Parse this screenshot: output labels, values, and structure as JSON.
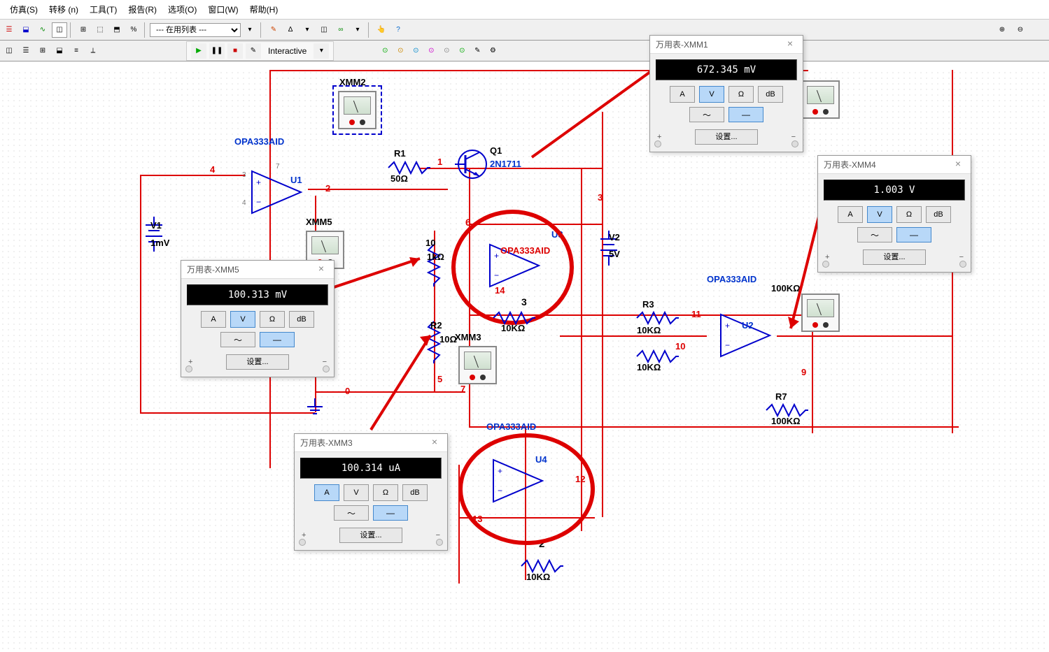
{
  "menu": {
    "sim": "仿真(S)",
    "trans": "转移 (n)",
    "tool": "工具(T)",
    "report": "报告(R)",
    "opt": "选项(O)",
    "win": "窗口(W)",
    "help": "帮助(H)"
  },
  "toolbar": {
    "list": "--- 在用列表 ---",
    "interactive": "Interactive"
  },
  "multimeters": {
    "xmm1": {
      "title": "万用表-XMM1",
      "reading": "672.345 mV",
      "mode": "V",
      "wave": "dc",
      "set": "设置..."
    },
    "xmm3": {
      "title": "万用表-XMM3",
      "reading": "100.314 uA",
      "mode": "A",
      "wave": "dc",
      "set": "设置..."
    },
    "xmm4": {
      "title": "万用表-XMM4",
      "reading": "1.003 V",
      "mode": "V",
      "wave": "dc",
      "set": "设置..."
    },
    "xmm5": {
      "title": "万用表-XMM5",
      "reading": "100.313 mV",
      "mode": "V",
      "wave": "dc",
      "set": "设置..."
    }
  },
  "components": {
    "v1": {
      "ref": "V1",
      "val": "1mV"
    },
    "v2": {
      "ref": "V2",
      "val": "5V"
    },
    "u1": {
      "ref": "U1",
      "model": "OPA333AID"
    },
    "u2": {
      "ref": "U2",
      "model": "OPA333AID"
    },
    "u3": {
      "ref": "U3",
      "model": "OPA333AID"
    },
    "u4": {
      "ref": "U4",
      "model": "OPA333AID"
    },
    "r1": {
      "ref": "R1",
      "val": "50Ω"
    },
    "r2": {
      "ref": "R2",
      "val": "10Ω"
    },
    "r3up": {
      "ref": "R3",
      "val": "10KΩ"
    },
    "r3low": {
      "val": "10KΩ"
    },
    "r4": {
      "ref": "",
      "val": "10KΩ",
      "label": "3"
    },
    "r7": {
      "ref": "R7",
      "val": "100KΩ"
    },
    "r8": {
      "val": "100KΩ"
    },
    "r10": {
      "val": "1kΩ",
      "label": "10"
    },
    "rbot": {
      "val": "10KΩ"
    },
    "q1": {
      "ref": "Q1",
      "model": "2N1711"
    },
    "xmm2": {
      "ref": "XMM2"
    },
    "xmm3i": {
      "ref": "XMM3"
    },
    "xmm5i": {
      "ref": "XMM5"
    }
  },
  "nodes": {
    "n0": "0",
    "n1": "1",
    "n2": "2",
    "n3": "3",
    "n4": "4",
    "n5": "5",
    "n6": "6",
    "n7": "7",
    "n9": "9",
    "n10": "10",
    "n11": "11",
    "n12": "12",
    "n13": "13",
    "n14": "14",
    "nbot2": "2"
  }
}
